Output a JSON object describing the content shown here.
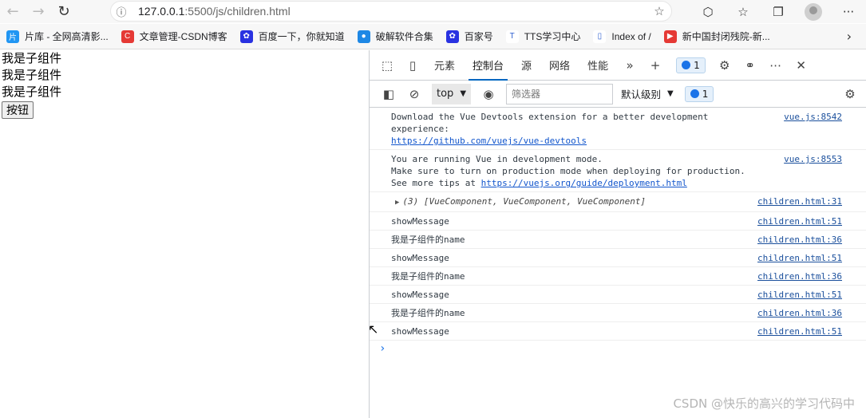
{
  "browser": {
    "url_host": "127.0.0.1",
    "url_path": ":5500/js/children.html",
    "bookmarks": [
      {
        "label": "片库 - 全网高清影...",
        "color": "#2196f3",
        "glyph": "片"
      },
      {
        "label": "文章管理-CSDN博客",
        "color": "#e53935",
        "glyph": "C"
      },
      {
        "label": "百度一下，你就知道",
        "color": "#2932e1",
        "glyph": "✿"
      },
      {
        "label": "破解软件合集",
        "color": "#1e88e5",
        "glyph": "●"
      },
      {
        "label": "百家号",
        "color": "#2932e1",
        "glyph": "✿"
      },
      {
        "label": "TTS学习中心",
        "color": "#ffffff",
        "glyph": "T"
      },
      {
        "label": "Index of /",
        "color": "#ffffff",
        "glyph": "▯"
      },
      {
        "label": "新中国封闭残院-新...",
        "color": "#e53935",
        "glyph": "▶"
      }
    ],
    "more_glyph": "›"
  },
  "page": {
    "lines": [
      "我是子组件",
      "我是子组件",
      "我是子组件"
    ],
    "button_label": "按钮"
  },
  "devtools": {
    "tabs": [
      "元素",
      "控制台",
      "源",
      "网络",
      "性能"
    ],
    "active_tab": "控制台",
    "issues_count": "1",
    "context": "top",
    "filter_placeholder": "筛选器",
    "level": "默认级别",
    "filter_issues_count": "1",
    "messages": [
      {
        "text": "Download the Vue Devtools extension for a better development\nexperience:",
        "link": "https://github.com/vuejs/vue-devtools",
        "src": "vue.js:8542"
      },
      {
        "text": "You are running Vue in development mode.\nMake sure to turn on production mode when deploying for production.\nSee more tips at ",
        "link": "https://vuejs.org/guide/deployment.html",
        "src": "vue.js:8553"
      },
      {
        "text": "(3) [VueComponent, VueComponent, VueComponent]",
        "src": "children.html:31",
        "object": true
      },
      {
        "text": "showMessage",
        "src": "children.html:51"
      },
      {
        "text": "我是子组件的name",
        "src": "children.html:36"
      },
      {
        "text": "showMessage",
        "src": "children.html:51"
      },
      {
        "text": "我是子组件的name",
        "src": "children.html:36"
      },
      {
        "text": "showMessage",
        "src": "children.html:51"
      },
      {
        "text": "我是子组件的name",
        "src": "children.html:36"
      },
      {
        "text": "showMessage",
        "src": "children.html:51"
      }
    ],
    "prompt": "›"
  },
  "watermark": "CSDN @快乐的高兴的学习代码中"
}
